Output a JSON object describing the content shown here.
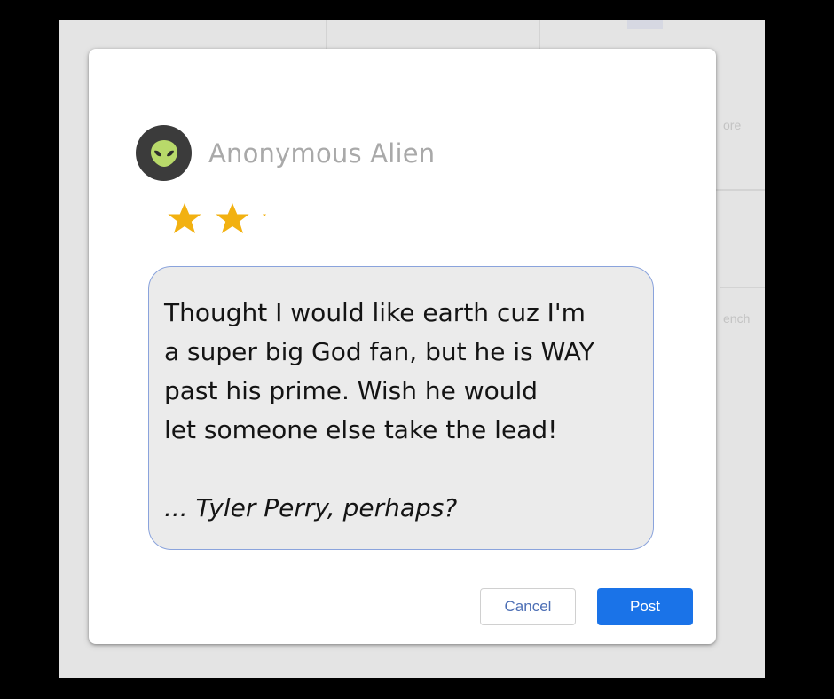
{
  "review": {
    "author_name": "Anonymous Alien",
    "avatar_icon": "alien-icon",
    "rating": 2.2,
    "rating_max": 5,
    "text_lines": [
      "Thought I would like earth cuz I'm",
      "a super big God fan, but he is WAY",
      "past his prime. Wish he would",
      "let someone else take the lead!"
    ],
    "signoff": "... Tyler Perry, perhaps?"
  },
  "actions": {
    "cancel_label": "Cancel",
    "post_label": "Post"
  },
  "background_text": {
    "item1": "ore",
    "item2": "ench"
  },
  "colors": {
    "star": "#f2b111",
    "post_button": "#1a73e8",
    "cancel_text": "#4d6fb5",
    "review_border": "#8aa3dc",
    "alien_face": "#b8d96a"
  }
}
